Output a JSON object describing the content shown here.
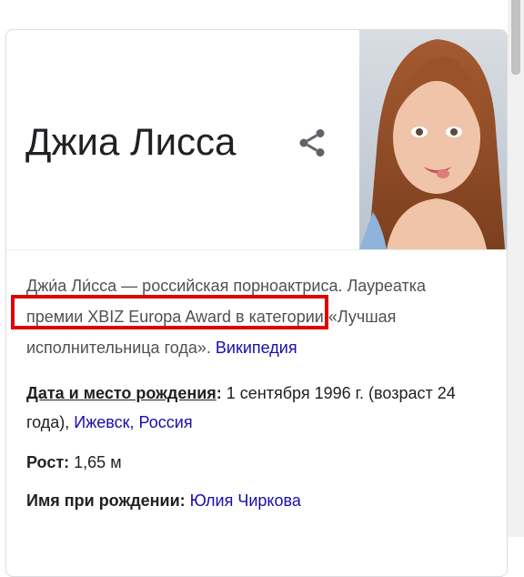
{
  "title": "Джиа Лисса",
  "description": {
    "text": "Джи́а Ли́сса — российская порноактриса. Лауреатка премии XBIZ Europa Award в категории «Лучшая исполнительница года».",
    "source_link": "Википедия"
  },
  "facts": {
    "birth": {
      "label": "Дата и место рождения",
      "value_prefix": "1 сентября 1996 г. (возраст 24 года), ",
      "city": "Ижевск",
      "sep": ", ",
      "country": "Россия"
    },
    "height": {
      "label": "Рост",
      "value": "1,65 м"
    },
    "birth_name": {
      "label": "Имя при рождении",
      "value": "Юлия Чиркова"
    }
  },
  "icons": {
    "share": "share-icon"
  },
  "colors": {
    "link": "#1a0dab",
    "highlight": "#e00000",
    "text": "#202124",
    "muted": "#4d5156"
  }
}
